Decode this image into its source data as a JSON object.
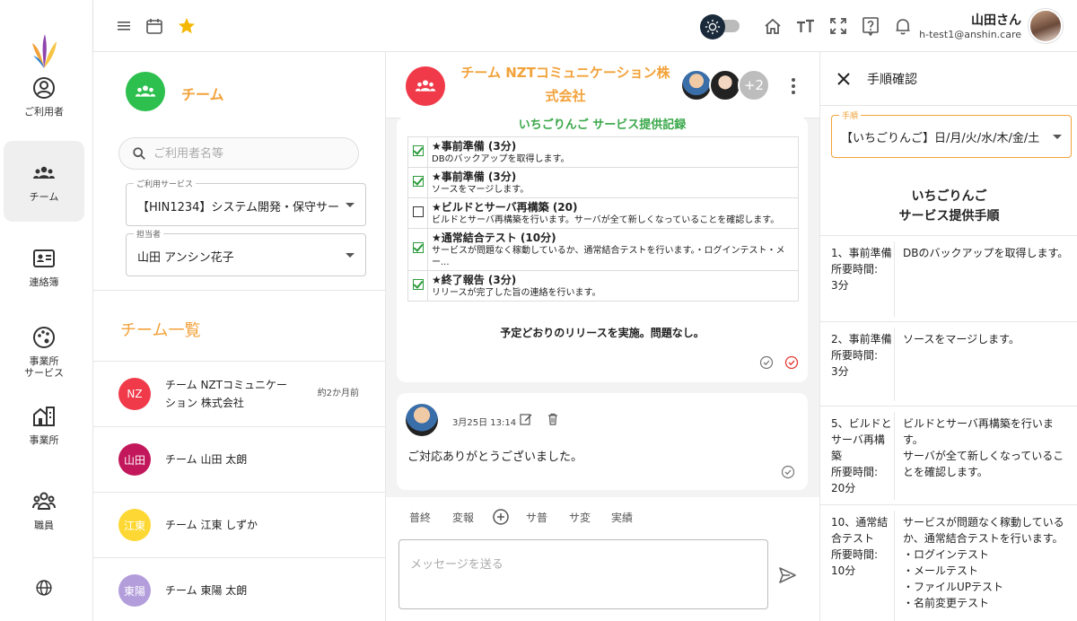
{
  "nav": {
    "items": [
      {
        "label": "ご利用者"
      },
      {
        "label": "チーム"
      },
      {
        "label": "連絡簿"
      },
      {
        "label": "事業所\nサービス"
      },
      {
        "label": "事業所"
      },
      {
        "label": "職員"
      }
    ]
  },
  "header": {
    "user_name": "山田さん",
    "user_email": "h-test1@anshin.care"
  },
  "team_panel": {
    "title": "チーム",
    "search_placeholder": "ご利用者名等",
    "service_label": "ご利用サービス",
    "service_value": "【HIN1234】システム開発・保守サービス",
    "staff_label": "担当者",
    "staff_value": "山田 アンシン花子",
    "list_title": "チーム一覧",
    "teams": [
      {
        "avatar_text": "NZ",
        "name": "チーム NZTコミュニケー\nション 株式会社",
        "time": "約2か月前",
        "color": "#f03a4a"
      },
      {
        "avatar_text": "山田",
        "name": "チーム 山田 太朗",
        "time": "",
        "color": "#c2185b"
      },
      {
        "avatar_text": "江東",
        "name": "チーム 江東 しずか",
        "time": "",
        "color": "#fdd835"
      },
      {
        "avatar_text": "東陽",
        "name": "チーム 東陽 太朗",
        "time": "",
        "color": "#b39ddb"
      }
    ]
  },
  "chat": {
    "title": "チーム NZTコミュニケーション株式会社",
    "extra_members": "+2",
    "record_title": "いちごりんご サービス提供記録",
    "steps": [
      {
        "checked": true,
        "title": "★事前準備 (3分)",
        "desc": "DBのバックアップを取得します。"
      },
      {
        "checked": true,
        "title": "★事前準備 (3分)",
        "desc": "ソースをマージします。"
      },
      {
        "checked": false,
        "title": "★ビルドとサーバ再構築 (20)",
        "desc": "ビルドとサーバ再構築を行います。サーバが全て新しくなっていることを確認します。"
      },
      {
        "checked": true,
        "title": "★通常結合テスト (10分)",
        "desc": "サービスが問題なく稼動しているか、通常結合テストを行います。・ログインテスト・メー..."
      },
      {
        "checked": true,
        "title": "★終了報告 (3分)",
        "desc": "リリースが完了した旨の連絡を行います。"
      }
    ],
    "summary": "予定どおりのリリースを実施。問題なし。",
    "message_time": "3月25日 13:14",
    "message_text": "ご対応ありがとうございました。",
    "quick_replies": [
      "普終",
      "変報",
      "サ普",
      "サ変",
      "実績"
    ],
    "input_placeholder": "メッセージを送る"
  },
  "procedure": {
    "title": "手順確認",
    "select_label": "手順",
    "select_value": "【いちごりんご】日/月/火/水/木/金/土",
    "heading_line1": "いちごりんご",
    "heading_line2": "サービス提供手順",
    "rows": [
      {
        "left": "1、事前準備\n所要時間:\n3分",
        "right": "DBのバックアップを取得します。"
      },
      {
        "left": "2、事前準備\n所要時間:\n3分",
        "right": "ソースをマージします。"
      },
      {
        "left": "5、ビルドとサーバ再構築\n所要時間:\n20分",
        "right": "ビルドとサーバ再構築を行います。\nサーバが全て新しくなっていることを確認します。"
      },
      {
        "left": "10、通常結合テスト\n所要時間:\n10分",
        "right": "サービスが問題なく稼動しているか、通常結合テストを行います。\n・ログインテスト\n・メールテスト\n・ファイルUPテスト\n・名前変更テスト"
      }
    ]
  },
  "colors": {
    "accent_orange": "#f2a23a",
    "team_green": "#2dc04e",
    "chat_red": "#f03a4a",
    "check_green": "#2a9a3a"
  }
}
